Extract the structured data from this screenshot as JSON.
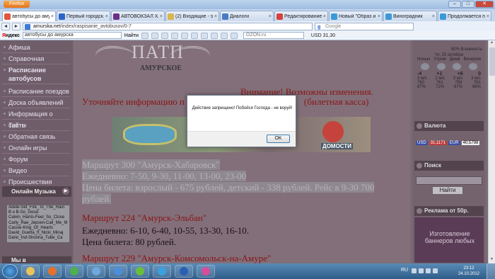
{
  "window": {
    "app_button": "Firefox",
    "controls": [
      "–",
      "□",
      "✕"
    ]
  },
  "tabs": [
    {
      "title": "автобусы до аму...",
      "color": "#e0553d",
      "close": "×"
    },
    {
      "title": "Первый городск...",
      "color": "#2a66c8",
      "close": "×"
    },
    {
      "title": "АВТОВОКЗАЛ ХАБ...",
      "color": "#6b2f86",
      "close": "×"
    },
    {
      "title": "(2) Входящие - s...",
      "color": "#d9b54a",
      "close": "×"
    },
    {
      "title": "Диалоги",
      "color": "#4a7cc4",
      "close": "×"
    },
    {
      "title": "Редактирование ...",
      "color": "#d8403a",
      "close": "×"
    },
    {
      "title": "Новый \"Образ и ...",
      "color": "#3a9ad9",
      "close": "×"
    },
    {
      "title": "Виноградник",
      "color": "#3a9ad9",
      "close": "×"
    },
    {
      "title": "Продолжается п...",
      "color": "#3a9ad9",
      "close": "×"
    }
  ],
  "nav": {
    "back": "◄",
    "forward": "►",
    "url_domain": "amurska.net",
    "url_path": "/index/raspisanie_avtobusov/0-7",
    "search_engine": "g",
    "search_placeholder": "Google"
  },
  "yandex": {
    "logo_y": "Я",
    "logo_rest": "ндекс",
    "query": "автобусы до амурска",
    "find_label": "Найти",
    "ozon_placeholder": "OZON.ru",
    "usd": "USD 31,30"
  },
  "left_menu": {
    "items": [
      "Афиша",
      "Справочная",
      "Расписание автобусов",
      "Расписание поездов",
      "Доска объявлений",
      "Информация о сайте",
      "Тесты",
      "Обратная связь",
      "Онлайн игры",
      "Форум",
      "Видео",
      "Происшествия"
    ],
    "music_title": "Онлайн Музыка",
    "playlist": [
      "Adele-Set_Fire_To_The_Rain",
      "B o B-So_Good",
      "Calvin_Harris-Feel_So_Close",
      "Carly_Rae_Jepsen-Call_Me_M",
      "Cassie-King_Of_Hearts",
      "David_Guetta_ft_Nicki_Minaj",
      "Dario_Ind-Shonna_Tube_Ca"
    ],
    "bottom_title": "Мы в"
  },
  "center": {
    "logo_word": "ПАТП",
    "logo_sub": "АМУРСКОЕ",
    "warning": "Внимание! Возможны изменения.",
    "info_left": "Уточняйте информацию п",
    "info_right": "(билетная касса)",
    "banner_brand": "ДОМОСТИ",
    "routes": [
      {
        "text": "Маршрут 300 \"Амурск-Хабаровск\"",
        "style": "sel"
      },
      {
        "text": "Ежедневно: 7-50, 9-30, 11-00, 13-00, 23-00",
        "style": "sel"
      },
      {
        "text": "Цена билета: взрослый - 675 рублей, детский - 338 рублей. Рейс в 9-30 700",
        "style": "sel"
      },
      {
        "text": "рублей.",
        "style": "sel"
      },
      {
        "text": "Маршрут 224 \"Амурск-Эльбан\"",
        "style": "red"
      },
      {
        "text": "Ежедневно: 6-10, 6-40, 10-55, 13-30, 16-10.",
        "style": ""
      },
      {
        "text": "Цена билета: 80 рублей.",
        "style": ""
      },
      {
        "text": "Маршрут 229 \"Амурск-Комсомольск-на-Амуре\"",
        "style": "red"
      }
    ]
  },
  "right": {
    "humidity": "80% Влажность",
    "date": "Чт, 25 октября",
    "periods": [
      "Ночью",
      "Утром",
      "Днем",
      "Вечером"
    ],
    "temps": [
      "-4",
      "+1",
      "+6",
      "0"
    ],
    "winds": [
      "3 м/с",
      "2 м/с",
      "3 м/с",
      "3 м/с"
    ],
    "pressure": [
      "760",
      "761",
      "759",
      "761"
    ],
    "humid": [
      "87%",
      "72%",
      "67%",
      "86%"
    ],
    "currency_title": "Валюта",
    "usd_label": "USD",
    "usd_value": "31,1171",
    "eur_label": "EUR",
    "eur_value": "40,5798",
    "search_title": "Поиск",
    "search_button": "Найти",
    "ad_title": "Реклама от 50р.",
    "ad_text": "Изготовление баннеров любых"
  },
  "dialog": {
    "message": "Действие запрещено! Побойся Господа - не воруй!",
    "ok": "OK"
  },
  "taskbar": {
    "lang": "RU",
    "time": "23:12",
    "date": "24.10.2012",
    "apps": [
      {
        "name": "explorer",
        "color": "#e8c35a"
      },
      {
        "name": "firefox",
        "color": "#e6712c"
      },
      {
        "name": "chrome",
        "color": "#4caf50"
      },
      {
        "name": "screen",
        "color": "#6fa8dc"
      },
      {
        "name": "ie",
        "color": "#4d8ed9"
      },
      {
        "name": "utorrent",
        "color": "#6abf3a"
      },
      {
        "name": "skype",
        "color": "#3aa0e0"
      },
      {
        "name": "word",
        "color": "#2b5fb3"
      },
      {
        "name": "picasa",
        "color": "#d64e9a"
      }
    ]
  }
}
